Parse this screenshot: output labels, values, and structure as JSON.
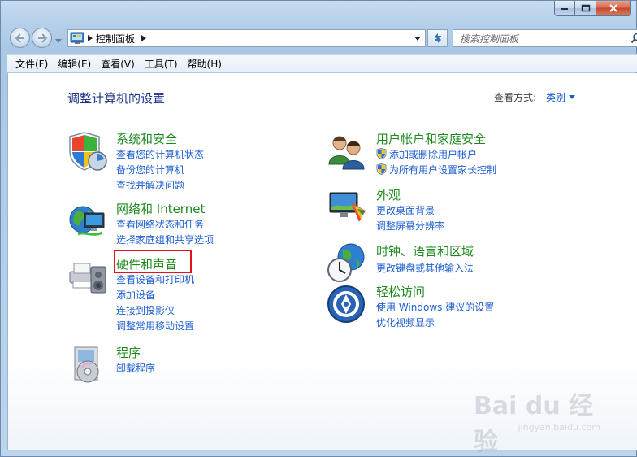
{
  "window": {
    "address_path": "控制面板",
    "search_placeholder": "搜索控制面板"
  },
  "menu": [
    "文件(F)",
    "编辑(E)",
    "查看(V)",
    "工具(T)",
    "帮助(H)"
  ],
  "content": {
    "page_title": "调整计算机的设置",
    "view_label": "查看方式:",
    "view_value": "类别"
  },
  "categories": {
    "system": {
      "title": "系统和安全",
      "links": [
        "查看您的计算机状态",
        "备份您的计算机",
        "查找并解决问题"
      ]
    },
    "network": {
      "title": "网络和 Internet",
      "links": [
        "查看网络状态和任务",
        "选择家庭组和共享选项"
      ]
    },
    "hardware": {
      "title": "硬件和声音",
      "links": [
        "查看设备和打印机",
        "添加设备",
        "连接到投影仪",
        "调整常用移动设置"
      ]
    },
    "programs": {
      "title": "程序",
      "links": [
        "卸载程序"
      ]
    },
    "users": {
      "title": "用户帐户和家庭安全",
      "links": [
        "添加或删除用户帐户",
        "为所有用户设置家长控制"
      ]
    },
    "appearance": {
      "title": "外观",
      "links": [
        "更改桌面背景",
        "调整屏幕分辨率"
      ]
    },
    "clock": {
      "title": "时钟、语言和区域",
      "links": [
        "更改键盘或其他输入法"
      ]
    },
    "ease": {
      "title": "轻松访问",
      "links": [
        "使用 Windows 建议的设置",
        "优化视频显示"
      ]
    }
  },
  "watermark": {
    "brand": "Bai du 经验",
    "url": "jingyan.baidu.com"
  },
  "colors": {
    "category_title": "#1e8a1e",
    "link": "#1c5ed1",
    "page_title": "#1e3287",
    "highlight": "#e2141b"
  }
}
